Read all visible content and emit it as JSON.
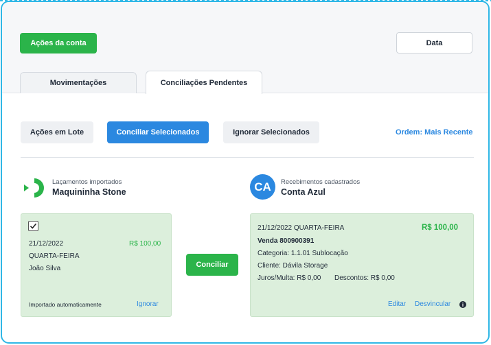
{
  "header": {
    "account_actions_label": "Ações da conta",
    "date_label": "Data"
  },
  "tabs": [
    {
      "label": "Movimentações",
      "active": false
    },
    {
      "label": "Conciliações Pendentes",
      "active": true
    }
  ],
  "toolbar": {
    "batch_actions_label": "Ações em Lote",
    "reconcile_selected_label": "Conciliar Selecionados",
    "ignore_selected_label": "Ignorar Selecionados",
    "order_label": "Ordem: Mais Recente"
  },
  "left_source": {
    "subtitle": "Laçamentos importados",
    "name": "Maquininha Stone",
    "icon": "stone-logo-icon"
  },
  "right_source": {
    "subtitle": "Recebimentos cadastrados",
    "name": "Conta Azul",
    "avatar_text": "CA"
  },
  "left_card": {
    "checked": true,
    "date": "21/12/2022",
    "amount": "R$ 100,00",
    "weekday": "QUARTA-FEIRA",
    "person": "João Silva",
    "footer_note": "Importado automaticamente",
    "ignore_label": "Ignorar"
  },
  "reconcile_button_label": "Conciliar",
  "right_card": {
    "date_weekday": "21/12/2022 QUARTA-FEIRA",
    "amount": "R$ 100,00",
    "sale": "Venda 800900391",
    "category": "Categoria: 1.1.01 Sublocação",
    "client": "Cliente: Dávila Storage",
    "interest": "Juros/Multa: R$ 0,00",
    "discounts": "Descontos: R$ 0,00",
    "edit_label": "Editar",
    "unlink_label": "Desvincular",
    "info_glyph": "i"
  },
  "colors": {
    "accent_green": "#2bb44a",
    "accent_blue": "#2b88e0",
    "card_green": "#dcefdc",
    "frame_border": "#2fb7e6"
  }
}
